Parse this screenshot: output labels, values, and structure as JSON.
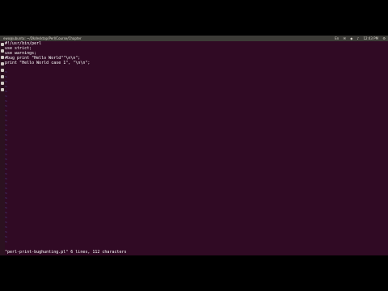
{
  "window": {
    "title": "ewo@ubuntu: ~/Dkdesktop/Perl/Course/Chapter",
    "indicators": [
      "En",
      "✉",
      "◆",
      "♪",
      "12:43 PM",
      "⚙"
    ]
  },
  "editor": {
    "lines": [
      "#!/usr/bin/perl",
      "use strict;",
      "use warnings;",
      "#bug print \"Hello World\"\"\\n\\n\";",
      "print \"Hello World case 1\", \"\\n\\n\";"
    ],
    "filler": "~"
  },
  "status_line": "\"perl-print-bughunting.pl\" 6 lines, 112 characters",
  "colors": {
    "background": "#300a24",
    "text": "#ffffff",
    "tilde": "#4d4d9a",
    "panel": "#3c3b37"
  }
}
